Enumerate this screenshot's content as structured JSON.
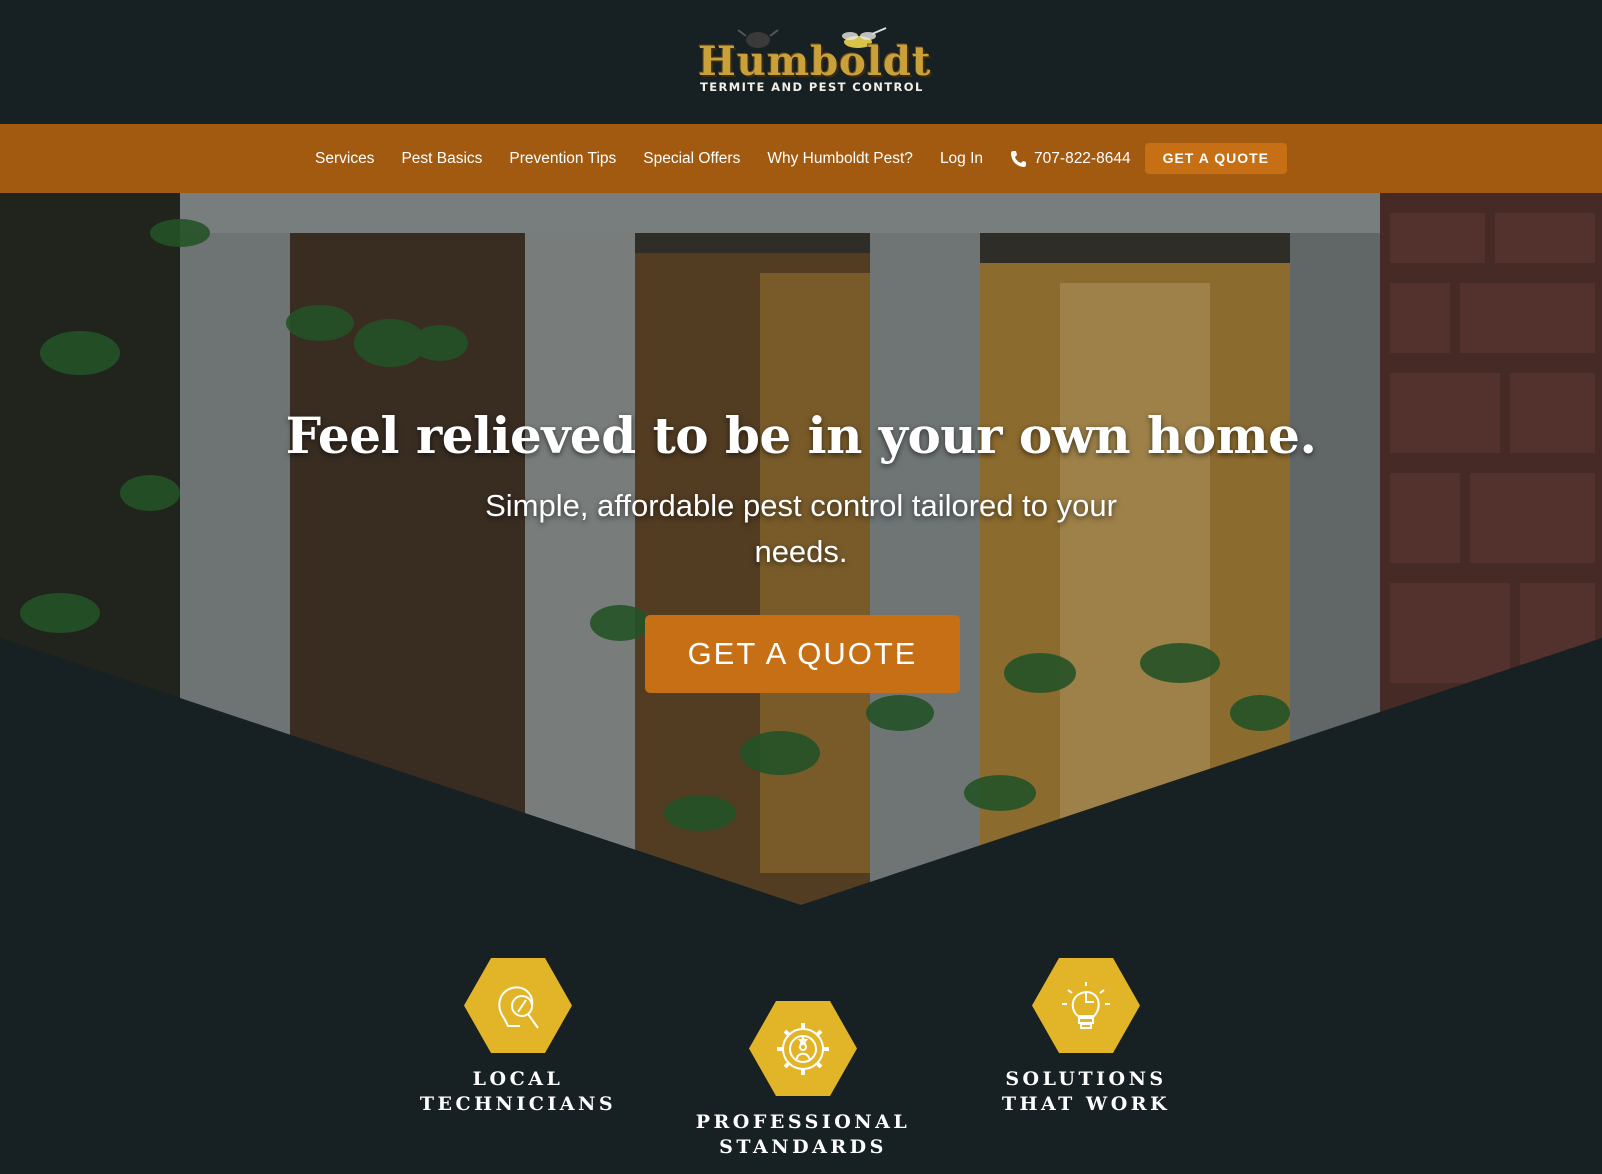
{
  "header": {
    "logo_text": "Humboldt",
    "logo_subtext": "TERMITE AND PEST CONTROL"
  },
  "nav": {
    "items": [
      "Services",
      "Pest Basics",
      "Prevention Tips",
      "Special Offers",
      "Why Humboldt Pest?",
      "Log In"
    ],
    "phone": "707-822-8644",
    "quote_label": "GET A QUOTE"
  },
  "hero": {
    "title": "Feel relieved to be in your own home.",
    "subtitle": "Simple, affordable pest control tailored to your needs.",
    "cta_label": "GET A QUOTE"
  },
  "features": [
    {
      "line1": "LOCAL",
      "line2": "TECHNICIANS",
      "icon": "magnifier-head-icon"
    },
    {
      "line1": "PROFESSIONAL",
      "line2": "STANDARDS",
      "icon": "gear-badge-icon"
    },
    {
      "line1": "SOLUTIONS",
      "line2": "THAT WORK",
      "icon": "lightbulb-puzzle-icon"
    }
  ],
  "colors": {
    "background": "#172022",
    "nav_bar": "#a15a0f",
    "accent_orange": "#c66f14",
    "hex_yellow": "#e2b427"
  }
}
